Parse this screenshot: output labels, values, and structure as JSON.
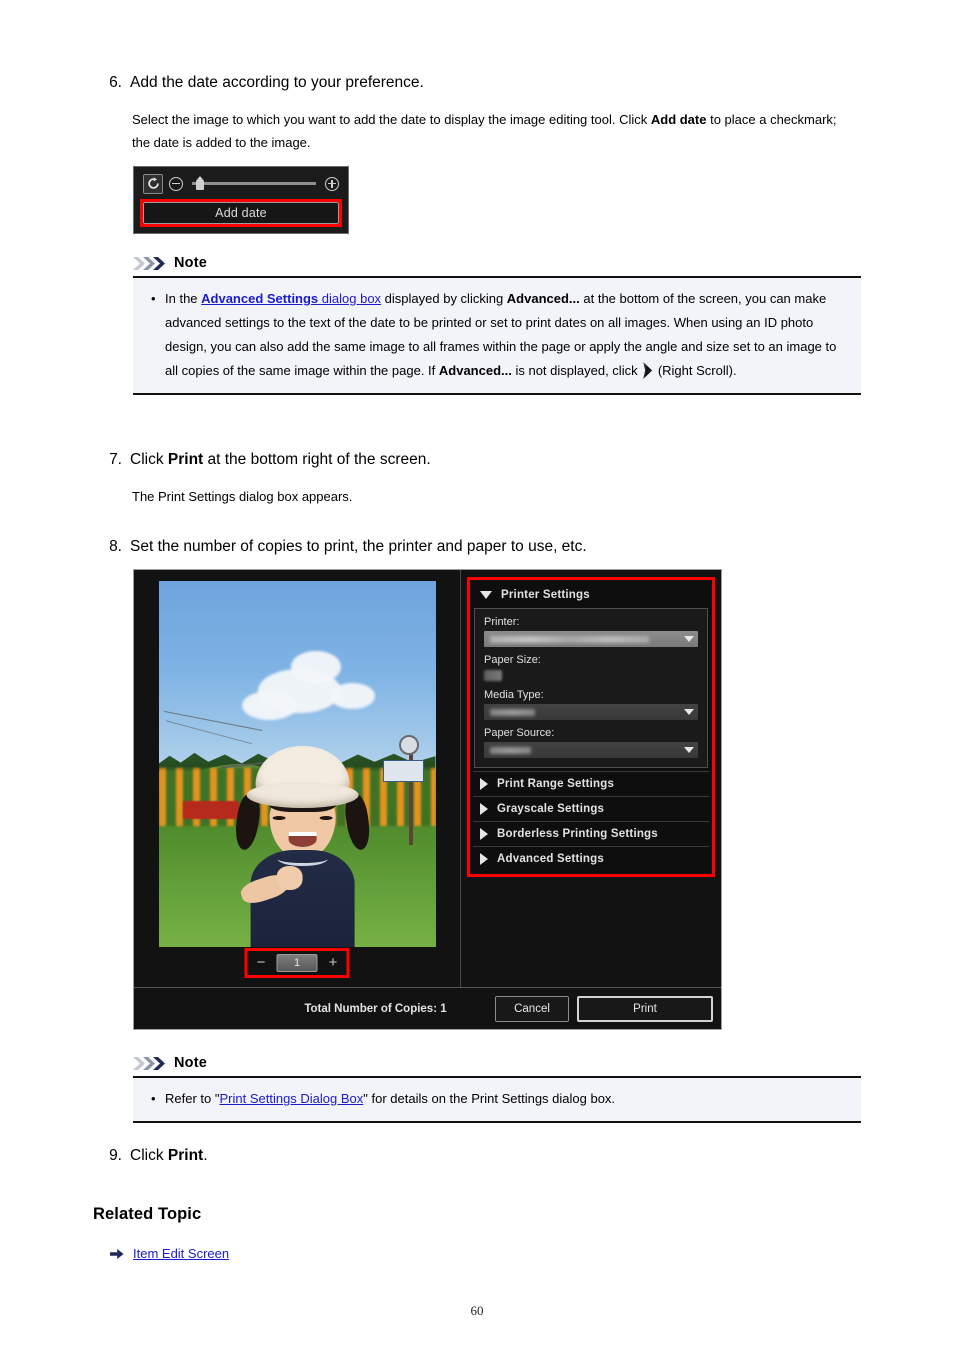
{
  "page": {
    "number": "60"
  },
  "steps": {
    "s6": {
      "num": "6.",
      "title": "Add the date according to your preference.",
      "body_1": "Select the image to which you want to add the date to display the image editing tool. Click ",
      "body_bold": "Add date",
      "body_2": " to place a checkmark; the date is added to the image."
    },
    "s7": {
      "num": "7.",
      "title_pre": "Click ",
      "title_bold": "Print",
      "title_post": " at the bottom right of the screen.",
      "body": "The Print Settings dialog box appears."
    },
    "s8": {
      "num": "8.",
      "title": "Set the number of copies to print, the printer and paper to use, etc."
    },
    "s9": {
      "num": "9.",
      "title_pre": "Click ",
      "title_bold": "Print",
      "title_post": "."
    }
  },
  "note1": {
    "heading": "Note",
    "t1": "In the ",
    "link_bold": "Advanced Settings",
    "link_rest": " dialog box",
    "t2": " displayed by clicking ",
    "b1": "Advanced...",
    "t3": " at the bottom of the screen, you can make advanced settings to the text of the date to be printed or set to print dates on all images. When using an ID photo design, you can also add the same image to all frames within the page or apply the angle and size set to an image to all copies of the same image within the page. If ",
    "b2": "Advanced...",
    "t4": " is not displayed, click ",
    "icon": "right-scroll-icon",
    "t5": " (Right Scroll)."
  },
  "note2": {
    "heading": "Note",
    "t1": "Refer to \"",
    "link": "Print Settings Dialog Box",
    "t2": "\" for details on the Print Settings dialog box."
  },
  "related": {
    "heading": "Related Topic",
    "link": "Item Edit Screen"
  },
  "edit_tool": {
    "rotate_icon": "rotate-icon",
    "zoom_out_icon": "zoom-out-icon",
    "zoom_in_icon": "zoom-in-icon",
    "add_date_label": "Add date"
  },
  "print_dialog": {
    "copies": {
      "decrement": "−",
      "value": "1",
      "increment": "+"
    },
    "footer": {
      "total_label": "Total Number of Copies: 1",
      "cancel_label": "Cancel",
      "print_label": "Print"
    },
    "settings": {
      "printer_settings_label": "Printer Settings",
      "fields": {
        "printer_label": "Printer:",
        "printer_value": "",
        "paper_size_label": "Paper Size:",
        "paper_size_value": "",
        "media_type_label": "Media Type:",
        "media_type_value": "",
        "paper_source_label": "Paper Source:",
        "paper_source_value": ""
      },
      "sections": [
        {
          "label": "Print Range Settings"
        },
        {
          "label": "Grayscale Settings"
        },
        {
          "label": "Borderless Printing Settings"
        },
        {
          "label": "Advanced Settings"
        }
      ]
    }
  },
  "colors": {
    "link": "#1a1ad0",
    "highlight_box": "#ff0000",
    "note_bg": "#f2f4fa",
    "dialog_bg": "#121212"
  }
}
